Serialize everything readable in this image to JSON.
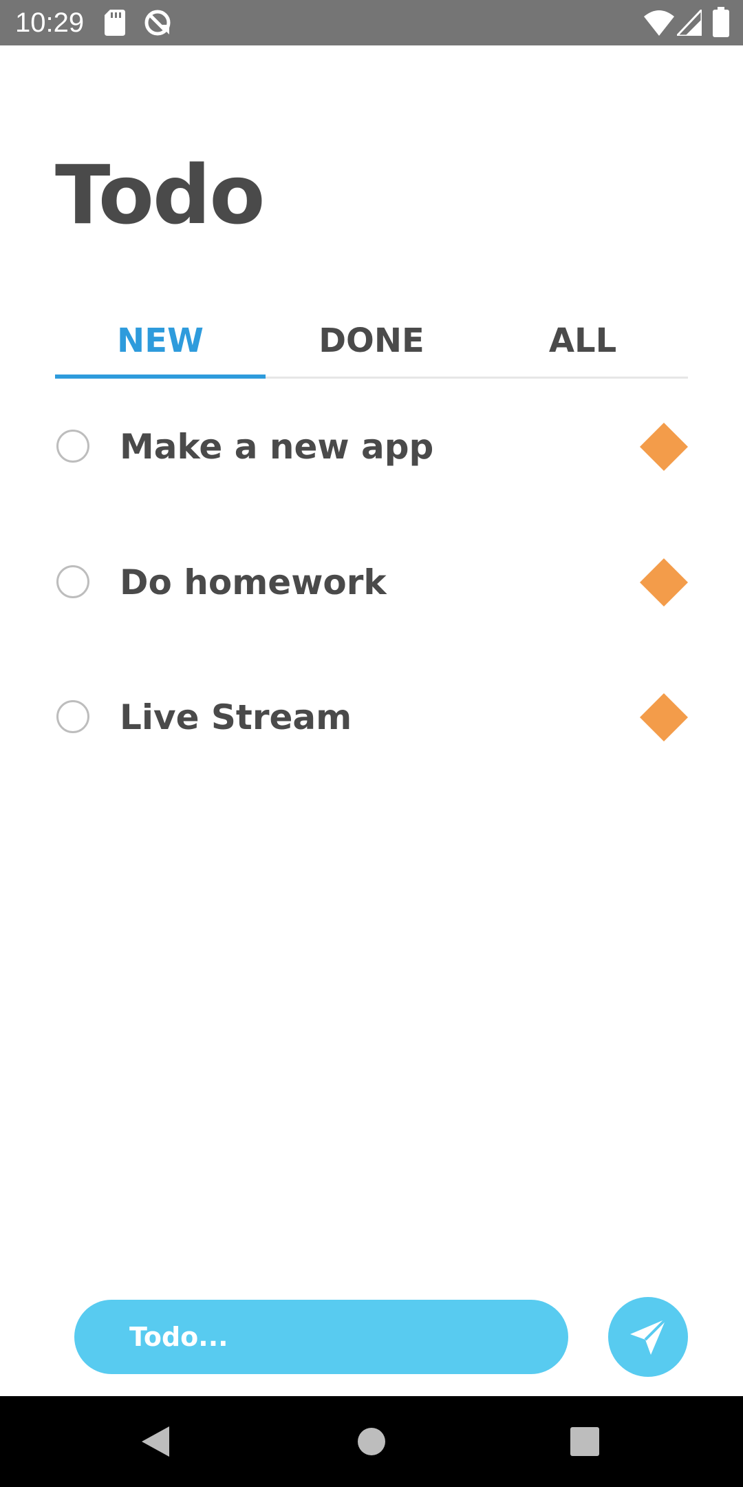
{
  "status_bar": {
    "time": "10:29",
    "icons": [
      "sd-card-icon",
      "sync-icon",
      "wifi-icon",
      "cell-signal-icon",
      "battery-icon"
    ]
  },
  "page": {
    "title": "Todo"
  },
  "tabs": [
    {
      "label": "NEW",
      "selected": true
    },
    {
      "label": "DONE",
      "selected": false
    },
    {
      "label": "ALL",
      "selected": false
    }
  ],
  "todos": [
    {
      "label": "Make a new app",
      "done": false,
      "priority_icon": "diamond-icon"
    },
    {
      "label": "Do homework",
      "done": false,
      "priority_icon": "diamond-icon"
    },
    {
      "label": "Live Stream",
      "done": false,
      "priority_icon": "diamond-icon"
    }
  ],
  "input": {
    "placeholder": "Todo...",
    "value": ""
  },
  "send_button": {
    "icon": "send-icon"
  },
  "nav_bar": {
    "icons": [
      "back-icon",
      "home-icon",
      "recents-icon"
    ]
  },
  "colors": {
    "accent": "#2e9bdc",
    "input_background": "#58cbf0",
    "priority": "#f39c4a",
    "text": "#4a4a4a",
    "status_bar": "#757575"
  }
}
